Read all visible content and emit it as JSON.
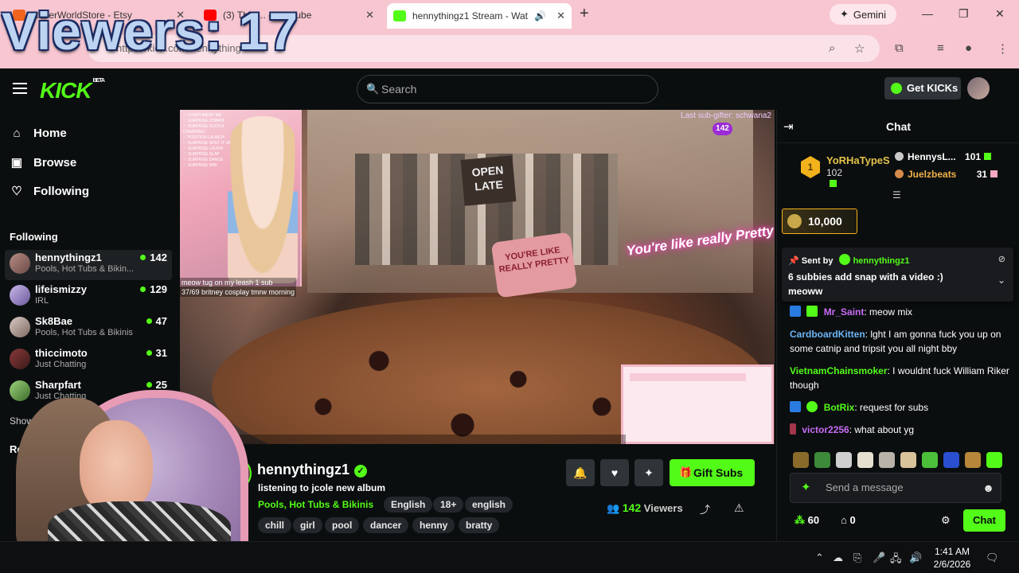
{
  "overlay": {
    "viewers": "Viewers: 17"
  },
  "browser": {
    "tabs": [
      {
        "title": "RoverWorldStore - Etsy",
        "favicon_color": "#f1641e"
      },
      {
        "title": "(3) This ... - YouTube",
        "favicon_color": "#ff0000"
      },
      {
        "title": "hennythingz1 Stream - Wat",
        "favicon_color": "#53fc18"
      }
    ],
    "new_tab": "+",
    "gemini": "Gemini",
    "url": "https://kick.com/hennything"
  },
  "kick": {
    "logo": "KICK",
    "beta": "BETA",
    "search_placeholder": "Search",
    "get_kicks": "Get KICKs"
  },
  "sidebar": {
    "nav": [
      {
        "label": "Home",
        "icon": "home-icon"
      },
      {
        "label": "Browse",
        "icon": "browse-icon"
      },
      {
        "label": "Following",
        "icon": "heart-icon"
      }
    ],
    "following_label": "Following",
    "following": [
      {
        "name": "hennythingz1",
        "category": "Pools, Hot Tubs & Bikin...",
        "viewers": "142"
      },
      {
        "name": "lifeismizzy",
        "category": "IRL",
        "viewers": "129"
      },
      {
        "name": "Sk8Bae",
        "category": "Pools, Hot Tubs & Bikinis",
        "viewers": "47"
      },
      {
        "name": "thiccimoto",
        "category": "Just Chatting",
        "viewers": "31"
      },
      {
        "name": "Sharpfart",
        "category": "Just Chatting",
        "viewers": "25"
      }
    ],
    "show_more": "Show More",
    "recommended_label": "Recomm"
  },
  "video": {
    "goal_line1": "meow tug on my leash 1 sub",
    "goal_line2": "37/69 britney cosplay tmrw morning",
    "viewer_badge": "142",
    "subgoal_text": "Last sub-gifter: schwana2",
    "open_late": "OPEN LATE",
    "pillow_text": "YOU'RE LIKE REALLY PRETTY",
    "neon_text": "You're like really Pretty"
  },
  "stream": {
    "name": "hennythingz1",
    "title": "listening to jcole new album",
    "category": "Pools, Hot Tubs & Bikinis",
    "tags_row1": [
      "English",
      "18+",
      "english"
    ],
    "tags_row2": [
      "chill",
      "girl",
      "pool",
      "dancer",
      "henny",
      "bratty"
    ],
    "gift_subs": "Gift Subs",
    "viewers_count": "142",
    "viewers_label": "Viewers"
  },
  "chat": {
    "title": "Chat",
    "leaderboard": {
      "top": {
        "rank": "1",
        "name": "YoRHaTypeS",
        "score": "102"
      },
      "second": {
        "name": "HennysL...",
        "score": "101"
      },
      "third": {
        "name": "Juelzbeats",
        "score": "31"
      }
    },
    "kicks_amount": "10,000",
    "pinned": {
      "sent_by": "Sent by",
      "user": "hennythingz1",
      "message": "6 subbies add snap with a video :) meoww"
    },
    "messages": [
      {
        "user": "Mr_Saint",
        "text": ": meow mix",
        "color": "#c86cf5"
      },
      {
        "user": "CardboardKitten",
        "text": ": lght I am gonna fuck you up on some catnip and tripsit you all night bby",
        "color": "#6cb4f5"
      },
      {
        "user": "VietnamChainsmoker",
        "text": ": I wouldnt fuck William Riker though",
        "color": "#53fc18"
      },
      {
        "user": "BotRix",
        "text": ": request for subs",
        "color": "#53fc18"
      },
      {
        "user": "victor2256",
        "text": ": what about yg",
        "color": "#c86cf5"
      }
    ],
    "input_placeholder": "Send a message",
    "points": "60",
    "gifts": "0",
    "send_label": "Chat"
  },
  "taskbar": {
    "time": "1:41 AM",
    "date": "2/6/2026"
  }
}
